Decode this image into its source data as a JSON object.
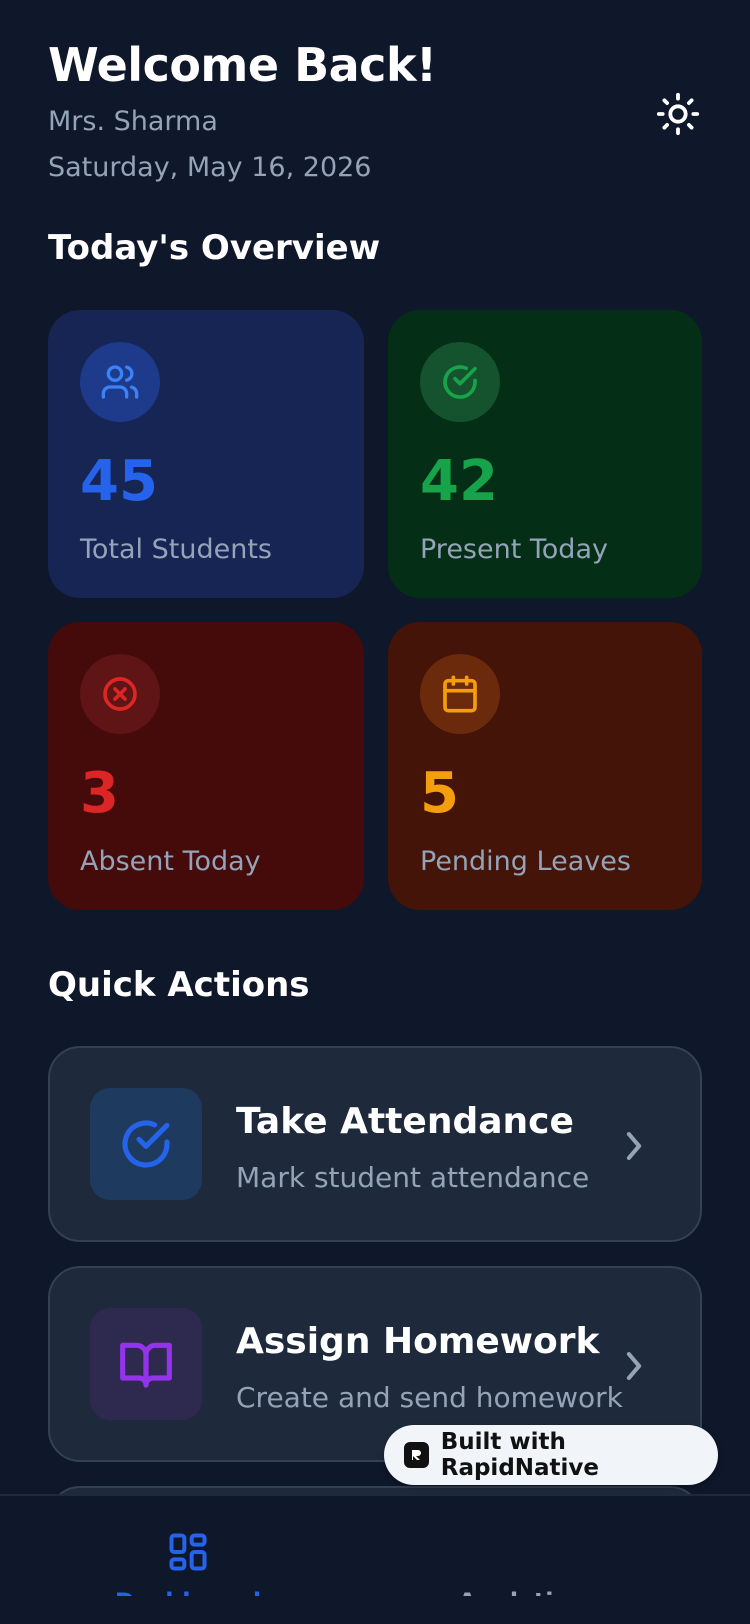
{
  "header": {
    "title": "Welcome Back!",
    "teacher_name": "Mrs. Sharma",
    "date": "Saturday, May 16, 2026",
    "theme_toggle_icon": "sun-icon"
  },
  "overview": {
    "title": "Today's Overview",
    "cards": [
      {
        "value": "45",
        "label": "Total Students",
        "icon": "users-icon",
        "color": "#2563eb"
      },
      {
        "value": "42",
        "label": "Present Today",
        "icon": "check-circle-icon",
        "color": "#16a34a"
      },
      {
        "value": "3",
        "label": "Absent Today",
        "icon": "x-circle-icon",
        "color": "#dc2626"
      },
      {
        "value": "5",
        "label": "Pending Leaves",
        "icon": "calendar-icon",
        "color": "#f59e0b"
      }
    ]
  },
  "quick_actions": {
    "title": "Quick Actions",
    "items": [
      {
        "title": "Take Attendance",
        "subtitle": "Mark student attendance",
        "icon": "check-circle-icon",
        "color": "#2563eb"
      },
      {
        "title": "Assign Homework",
        "subtitle": "Create and send homework",
        "icon": "book-open-icon",
        "color": "#9333ea"
      }
    ]
  },
  "badge": {
    "label": "Built with RapidNative"
  },
  "tabbar": {
    "tabs": [
      {
        "label": "Dashboard",
        "icon": "dashboard-icon",
        "active": true
      },
      {
        "label": "Analytics",
        "icon": "",
        "active": false
      }
    ],
    "active_color": "#2563eb"
  }
}
